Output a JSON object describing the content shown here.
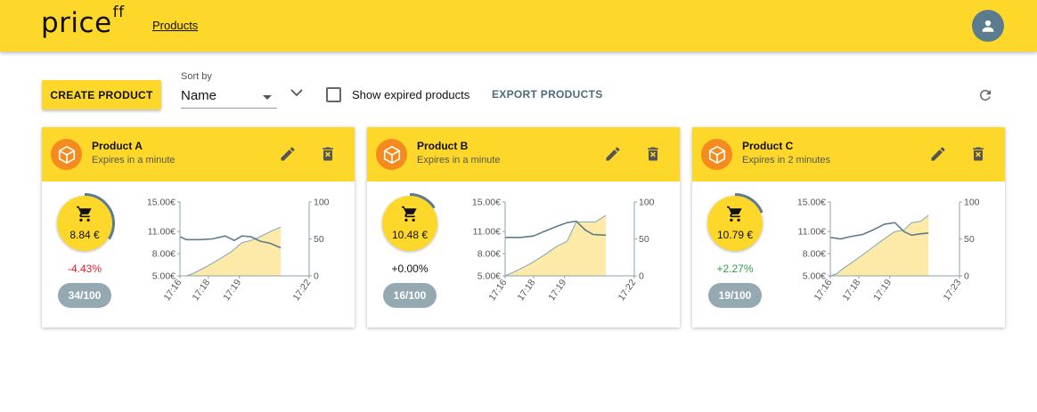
{
  "header": {
    "logo_text": "price",
    "logo_sup": "ff",
    "nav_products": "Products",
    "avatar_icon": "account-icon"
  },
  "toolbar": {
    "create_label": "CREATE PRODUCT",
    "sort_label": "Sort by",
    "sort_value": "Name",
    "show_expired_label": "Show expired products",
    "show_expired_checked": false,
    "export_label": "EXPORT PRODUCTS",
    "refresh_icon": "refresh-icon"
  },
  "colors": {
    "accent": "#fdd82a",
    "icon_orange": "#f58a1f",
    "line": "#5b7c8e",
    "area": "#fdeaa8",
    "negative": "#e0202a",
    "positive": "#2ba24c",
    "pill": "#94a9b2"
  },
  "cards": [
    {
      "title": "Product A",
      "subtitle": "Expires in a minute",
      "price": "8.84 €",
      "change": "-4.43%",
      "change_dir": "negative",
      "count": "34/100",
      "progress": 0.34,
      "chart_data": {
        "type": "line",
        "left_axis": {
          "ticks": [
            "15.00€",
            "11.00€",
            "8.00€",
            "5.00€"
          ],
          "values": [
            15,
            11,
            8,
            5
          ]
        },
        "right_axis": {
          "ticks": [
            "100",
            "50",
            "0"
          ],
          "values": [
            100,
            50,
            0
          ]
        },
        "x_ticks": [
          "17:16",
          "17:18",
          "17:19",
          "17:22"
        ],
        "series": [
          {
            "axis": "left",
            "style": "line",
            "x": [
              0,
              0.05,
              0.15,
              0.25,
              0.35,
              0.42,
              0.48,
              0.55,
              0.62,
              0.7,
              0.78
            ],
            "values": [
              10.3,
              9.9,
              9.9,
              10.0,
              10.4,
              9.8,
              10.4,
              10.3,
              9.7,
              9.4,
              8.8
            ]
          },
          {
            "axis": "right",
            "style": "area",
            "x": [
              0,
              0.05,
              0.1,
              0.2,
              0.3,
              0.4,
              0.48,
              0.55,
              0.62,
              0.7,
              0.78
            ],
            "values": [
              0,
              0,
              3,
              12,
              22,
              33,
              45,
              48,
              53,
              60,
              66
            ]
          }
        ]
      }
    },
    {
      "title": "Product B",
      "subtitle": "Expires in a minute",
      "price": "10.48 €",
      "change": "+0.00%",
      "change_dir": "neutral",
      "count": "16/100",
      "progress": 0.16,
      "chart_data": {
        "type": "line",
        "left_axis": {
          "ticks": [
            "15.00€",
            "11.00€",
            "8.00€",
            "5.00€"
          ],
          "values": [
            15,
            11,
            8,
            5
          ]
        },
        "right_axis": {
          "ticks": [
            "100",
            "50",
            "0"
          ],
          "values": [
            100,
            50,
            0
          ]
        },
        "x_ticks": [
          "17:16",
          "17:18",
          "17:19",
          "17:22"
        ],
        "series": [
          {
            "axis": "left",
            "style": "line",
            "x": [
              0,
              0.12,
              0.22,
              0.3,
              0.4,
              0.48,
              0.55,
              0.62,
              0.68,
              0.78
            ],
            "values": [
              10.2,
              10.2,
              10.4,
              11.0,
              11.7,
              12.2,
              12.4,
              11.2,
              10.6,
              10.5
            ]
          },
          {
            "axis": "right",
            "style": "area",
            "x": [
              0,
              0.1,
              0.2,
              0.3,
              0.4,
              0.48,
              0.55,
              0.62,
              0.7,
              0.78
            ],
            "values": [
              0,
              8,
              17,
              28,
              40,
              47,
              73,
              73,
              73,
              82
            ]
          }
        ]
      }
    },
    {
      "title": "Product C",
      "subtitle": "Expires in 2 minutes",
      "price": "10.79 €",
      "change": "+2.27%",
      "change_dir": "positive",
      "count": "19/100",
      "progress": 0.19,
      "chart_data": {
        "type": "line",
        "left_axis": {
          "ticks": [
            "15.00€",
            "11.00€",
            "8.00€",
            "5.00€"
          ],
          "values": [
            15,
            11,
            8,
            5
          ]
        },
        "right_axis": {
          "ticks": [
            "100",
            "50",
            "0"
          ],
          "values": [
            100,
            50,
            0
          ]
        },
        "x_ticks": [
          "17:16",
          "17:18",
          "17:19",
          "17:23"
        ],
        "series": [
          {
            "axis": "left",
            "style": "line",
            "x": [
              0,
              0.08,
              0.15,
              0.25,
              0.33,
              0.42,
              0.5,
              0.57,
              0.63,
              0.7,
              0.76
            ],
            "values": [
              10.2,
              10.0,
              10.3,
              10.6,
              11.2,
              12.0,
              12.2,
              11.0,
              10.5,
              10.7,
              10.8
            ]
          },
          {
            "axis": "right",
            "style": "area",
            "x": [
              0,
              0.05,
              0.1,
              0.2,
              0.3,
              0.4,
              0.5,
              0.57,
              0.63,
              0.7,
              0.76
            ],
            "values": [
              0,
              3,
              10,
              22,
              35,
              48,
              60,
              62,
              72,
              74,
              82
            ]
          }
        ]
      }
    }
  ]
}
